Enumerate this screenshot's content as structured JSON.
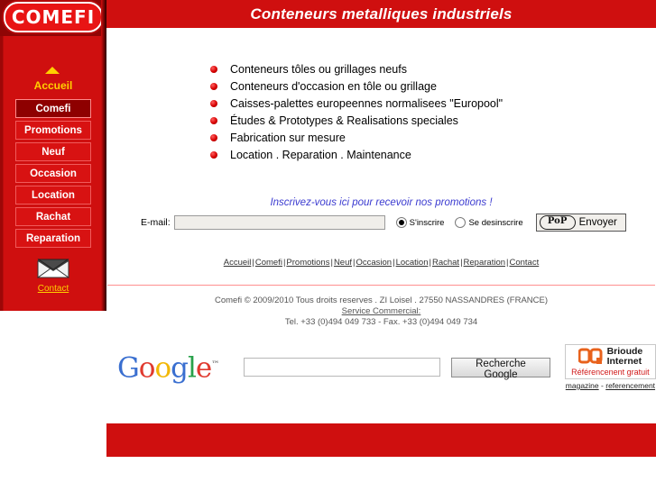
{
  "header": {
    "title": "Conteneurs metalliques industriels"
  },
  "sidebar": {
    "logo": "COMEFI",
    "home_label": "Accueil",
    "items": [
      {
        "label": "Comefi",
        "active": true
      },
      {
        "label": "Promotions",
        "active": false
      },
      {
        "label": "Neuf",
        "active": false
      },
      {
        "label": "Occasion",
        "active": false
      },
      {
        "label": "Location",
        "active": false
      },
      {
        "label": "Rachat",
        "active": false
      },
      {
        "label": "Reparation",
        "active": false
      }
    ],
    "contact_label": "Contact",
    "mail_icon": "envelope-icon",
    "arrow_icon": "triangle-up-icon"
  },
  "main": {
    "features": [
      "Conteneurs tôles ou grillages neufs",
      "Conteneurs d'occasion en tôle ou grillage",
      "Caisses-palettes europeennes normalisees \"Europool\"",
      "Études & Prototypes & Realisations speciales",
      "Fabrication sur mesure",
      "Location . Reparation . Maintenance"
    ]
  },
  "newsletter": {
    "promo_text": "Inscrivez-vous ici pour recevoir nos promotions !",
    "email_label": "E-mail:",
    "email_value": "",
    "email_placeholder": "",
    "subscribe_label": "S'inscrire",
    "unsubscribe_label": "Se desinscrire",
    "selected": "subscribe",
    "send_badge": "PoP",
    "send_label": "Envoyer"
  },
  "footer": {
    "links": [
      "Accueil",
      "Comefi",
      "Promotions",
      "Neuf",
      "Occasion",
      "Location",
      "Rachat",
      "Reparation",
      "Contact"
    ],
    "separator": "|",
    "copyright": "Comefi © 2009/2010 Tous droits reserves . ZI Loisel . 27550 NASSANDRES (FRANCE)",
    "service_label": "Service Commercial:",
    "phone_line": "Tel. +33 (0)494 049 733 - Fax. +33 (0)494 049 734"
  },
  "google": {
    "logo_letters": [
      "G",
      "o",
      "o",
      "g",
      "l",
      "e"
    ],
    "trademark": "™",
    "search_value": "",
    "search_placeholder": "",
    "button_label": "Recherche Google"
  },
  "brioude": {
    "name_line1": "Brioude",
    "name_line2": "Internet",
    "tagline": "Référencenent gratuit",
    "foot_left": "magazine",
    "foot_sep": "-",
    "foot_right": "referencement",
    "logo_icon": "brioude-oq-icon"
  },
  "colors": {
    "brand_red": "#cf0f0f",
    "dark_red": "#8e0000",
    "accent_yellow": "#ffd000",
    "promo_blue": "#3b3bd0",
    "divider_pink": "#ff8f8f"
  }
}
